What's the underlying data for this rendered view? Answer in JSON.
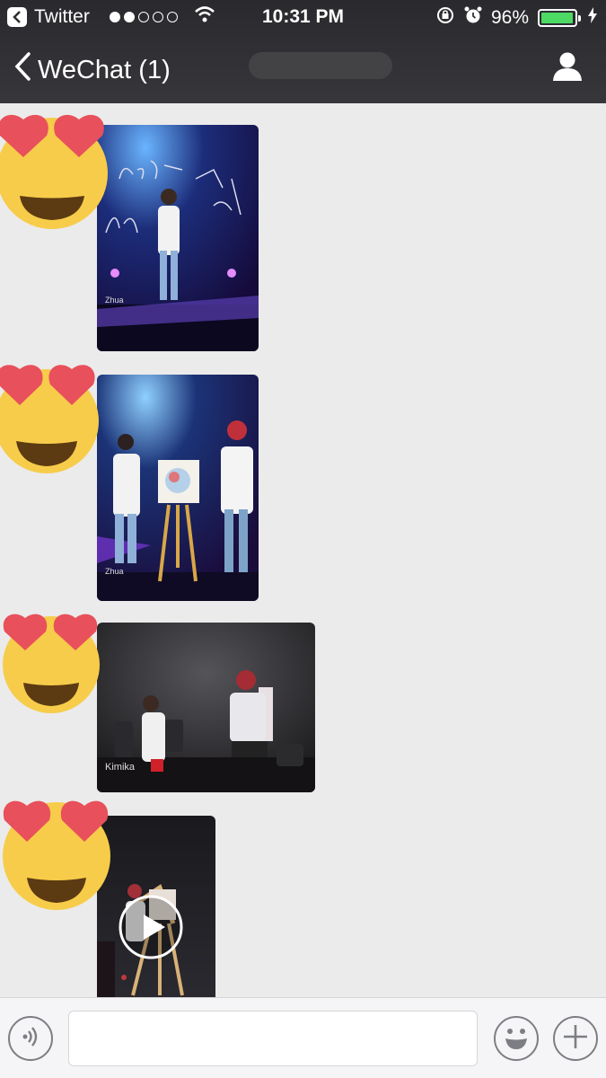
{
  "status_bar": {
    "back_app_label": "Twitter",
    "signal_dots_filled": 2,
    "signal_dots_total": 5,
    "time": "10:31 PM",
    "battery_percent": "96%",
    "battery_level": 0.96
  },
  "nav": {
    "back_label": "WeChat (1)",
    "title": ""
  },
  "messages": [
    {
      "type": "image",
      "emoji": "heart-eyes",
      "watermark": "Zhua",
      "photo_text": "your present"
    },
    {
      "type": "image",
      "emoji": "heart-eyes",
      "watermark": "Zhua"
    },
    {
      "type": "image",
      "emoji": "heart-eyes",
      "watermark": "Kimika"
    },
    {
      "type": "video",
      "emoji": "heart-eyes",
      "watermark": ""
    }
  ],
  "input_bar": {
    "voice_icon": "voice-icon",
    "text_value": "",
    "emoji_icon": "smiley-icon",
    "more_icon": "plus-icon"
  },
  "colors": {
    "nav_background": "#2f2f33",
    "chat_background": "#ebebeb",
    "battery_fill": "#4cd964"
  }
}
